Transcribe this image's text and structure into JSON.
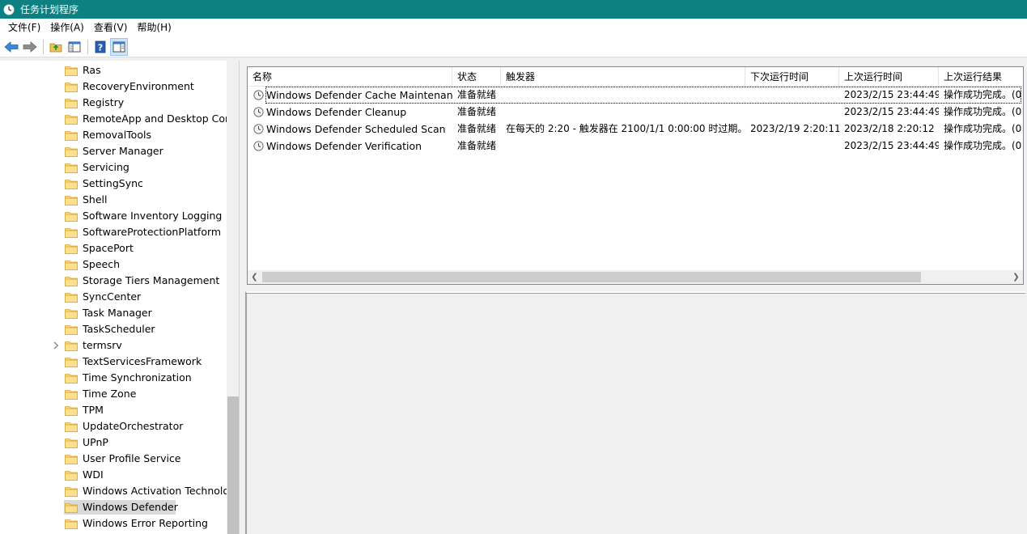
{
  "window": {
    "title": "任务计划程序"
  },
  "menu": [
    {
      "label": "文件(F)"
    },
    {
      "label": "操作(A)"
    },
    {
      "label": "查看(V)"
    },
    {
      "label": "帮助(H)"
    }
  ],
  "toolbar": {
    "buttons": [
      {
        "icon": "back-arrow-icon"
      },
      {
        "icon": "forward-arrow-icon"
      },
      {
        "icon": "up-folder-icon"
      },
      {
        "icon": "show-hide-console-tree-icon"
      },
      {
        "icon": "help-icon"
      },
      {
        "icon": "show-hide-action-pane-icon"
      }
    ]
  },
  "tree": {
    "items": [
      {
        "label": "Ras"
      },
      {
        "label": "RecoveryEnvironment"
      },
      {
        "label": "Registry"
      },
      {
        "label": "RemoteApp and Desktop Con"
      },
      {
        "label": "RemovalTools"
      },
      {
        "label": "Server Manager"
      },
      {
        "label": "Servicing"
      },
      {
        "label": "SettingSync"
      },
      {
        "label": "Shell"
      },
      {
        "label": "Software Inventory Logging"
      },
      {
        "label": "SoftwareProtectionPlatform"
      },
      {
        "label": "SpacePort"
      },
      {
        "label": "Speech"
      },
      {
        "label": "Storage Tiers Management"
      },
      {
        "label": "SyncCenter"
      },
      {
        "label": "Task Manager"
      },
      {
        "label": "TaskScheduler"
      },
      {
        "label": "termsrv"
      },
      {
        "label": "TextServicesFramework"
      },
      {
        "label": "Time Synchronization"
      },
      {
        "label": "Time Zone"
      },
      {
        "label": "TPM"
      },
      {
        "label": "UpdateOrchestrator"
      },
      {
        "label": "UPnP"
      },
      {
        "label": "User Profile Service"
      },
      {
        "label": "WDI"
      },
      {
        "label": "Windows Activation Technolog"
      },
      {
        "label": "Windows Defender"
      },
      {
        "label": "Windows Error Reporting"
      }
    ]
  },
  "task_list": {
    "columns": [
      "名称",
      "状态",
      "触发器",
      "下次运行时间",
      "上次运行时间",
      "上次运行结果"
    ],
    "rows": [
      {
        "name": "Windows Defender Cache Maintenance",
        "status": "准备就绪",
        "trigger": "",
        "next_run": "",
        "last_run": "2023/2/15 23:44:49",
        "last_result": "操作成功完成。(0"
      },
      {
        "name": "Windows Defender Cleanup",
        "status": "准备就绪",
        "trigger": "",
        "next_run": "",
        "last_run": "2023/2/15 23:44:49",
        "last_result": "操作成功完成。(0"
      },
      {
        "name": "Windows Defender Scheduled Scan",
        "status": "准备就绪",
        "trigger": "在每天的 2:20 - 触发器在 2100/1/1 0:00:00 时过期。",
        "next_run": "2023/2/19 2:20:11",
        "last_run": "2023/2/18 2:20:12",
        "last_result": "操作成功完成。(0"
      },
      {
        "name": "Windows Defender Verification",
        "status": "准备就绪",
        "trigger": "",
        "next_run": "",
        "last_run": "2023/2/15 23:44:49",
        "last_result": "操作成功完成。(0"
      }
    ]
  },
  "colors": {
    "titlebar": "#0d8181",
    "selection": "#d9d9d9"
  }
}
